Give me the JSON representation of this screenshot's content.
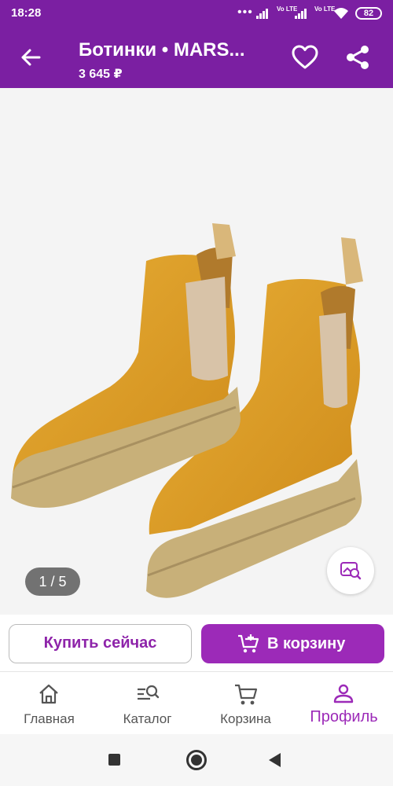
{
  "status_bar": {
    "time": "18:28",
    "dots": "•••",
    "lte1": "Vo LTE",
    "lte2": "Vo LTE",
    "battery": "82"
  },
  "header": {
    "title": "Ботинки • MARS...",
    "price": "3 645 ₽",
    "back_icon": "arrow-left-icon",
    "favorite_icon": "heart-outline-icon",
    "share_icon": "share-icon"
  },
  "gallery": {
    "counter": "1 / 5",
    "visual_search_icon": "image-search-icon",
    "boot_color": "#E0A42A",
    "sole_color": "#C7B07A"
  },
  "actions": {
    "buy_now": "Купить сейчас",
    "add_to_cart": "В корзину",
    "accent": "#9C2AB8"
  },
  "tabs": [
    {
      "label": "Главная",
      "icon": "home-icon"
    },
    {
      "label": "Каталог",
      "icon": "catalog-search-icon"
    },
    {
      "label": "Корзина",
      "icon": "cart-icon"
    },
    {
      "label": "Профиль",
      "icon": "profile-icon",
      "active": true
    }
  ],
  "colors": {
    "brand": "#7B1FA2"
  }
}
